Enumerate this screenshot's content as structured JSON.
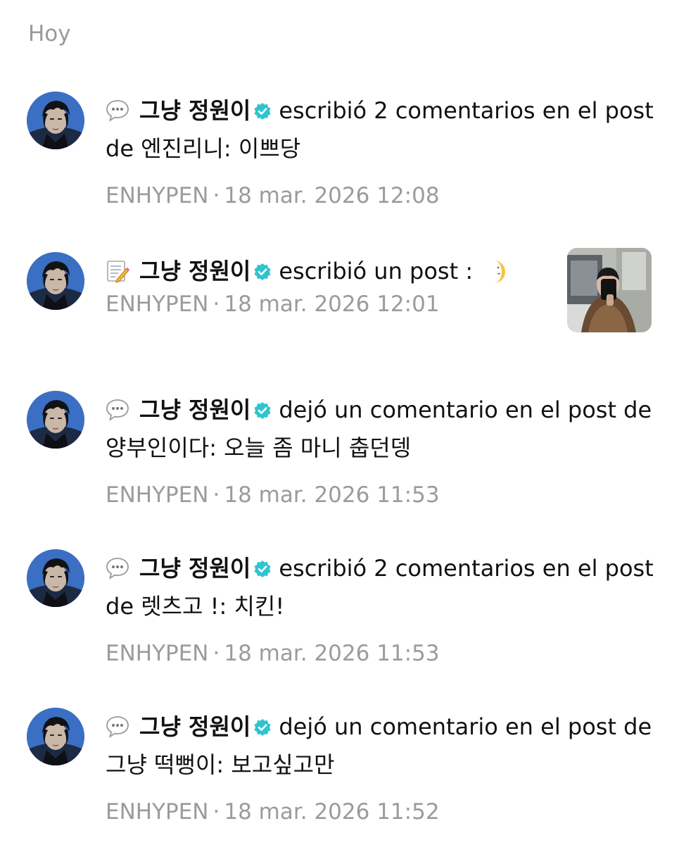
{
  "section": {
    "title": "Hoy"
  },
  "notifications": [
    {
      "author": "그냥 정원이",
      "action": "escribió 2 comentarios en el post de 엔진리니: 이쁘당",
      "community": "ENHYPEN",
      "separator": "·",
      "time": "18 mar. 2026 12:08",
      "icon": "speech-bubble-icon"
    },
    {
      "author": "그냥 정원이",
      "action": "escribió un post :",
      "community": "ENHYPEN",
      "separator": "·",
      "time": "18 mar. 2026 12:01",
      "icon": "memo-icon"
    },
    {
      "author": "그냥 정원이",
      "action": "dejó un comentario en el post de 양부인이다: 오늘 좀 마니 춥던뎅",
      "community": "ENHYPEN",
      "separator": "·",
      "time": "18 mar. 2026 11:53",
      "icon": "speech-bubble-icon"
    },
    {
      "author": "그냥 정원이",
      "action": "escribió 2 comentarios en el post de 렛츠고 !: 치킨!",
      "community": "ENHYPEN",
      "separator": "·",
      "time": "18 mar. 2026 11:53",
      "icon": "speech-bubble-icon"
    },
    {
      "author": "그냥 정원이",
      "action": "dejó un comentario en el post de 그냥 떡뻥이: 보고싶고만",
      "community": "ENHYPEN",
      "separator": "·",
      "time": "18 mar. 2026 11:52",
      "icon": "speech-bubble-icon"
    }
  ],
  "colors": {
    "verified": "#2fc4d0",
    "meta_text": "#9b9b9b",
    "section_title": "#9a9a9a"
  }
}
